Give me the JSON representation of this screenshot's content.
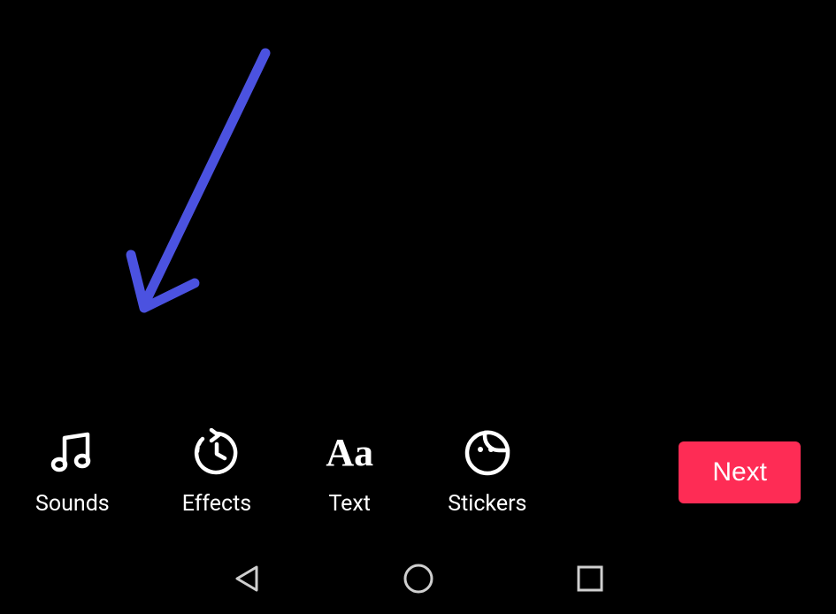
{
  "annotation": {
    "arrow_color": "#4b52e0"
  },
  "toolbar": {
    "items": [
      {
        "id": "sounds",
        "label": "Sounds",
        "icon": "music-note-icon"
      },
      {
        "id": "effects",
        "label": "Effects",
        "icon": "clock-effects-icon"
      },
      {
        "id": "text",
        "label": "Text",
        "icon": "text-aa-icon"
      },
      {
        "id": "stickers",
        "label": "Stickers",
        "icon": "sticker-face-icon"
      }
    ],
    "next_label": "Next"
  },
  "nav": {
    "back": "back",
    "home": "home",
    "recent": "recent"
  },
  "colors": {
    "background": "#000000",
    "foreground": "#ffffff",
    "accent": "#fe2c55",
    "annotation": "#4b52e0"
  }
}
